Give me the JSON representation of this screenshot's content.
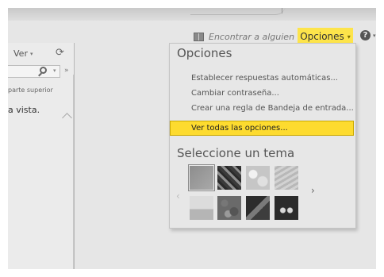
{
  "header": {
    "find_someone": "Encontrar a alguien",
    "options_label": "Opciones",
    "options_caret": "▾",
    "help_icon_glyph": "?",
    "help_caret": "▾"
  },
  "left_panel": {
    "view_label": "Ver",
    "view_caret": "▾",
    "refresh_glyph": "⟳",
    "search_dropdown_glyph": "▾",
    "expand_glyph": "»",
    "top_filter_text": "parte superior",
    "empty_view_text": "a vista."
  },
  "options_menu": {
    "title": "Opciones",
    "items": [
      {
        "label": "Establecer respuestas automáticas..."
      },
      {
        "label": "Cambiar contraseña..."
      },
      {
        "label": "Crear una regla de Bandeja de entrada..."
      },
      {
        "label": "Ver todas las opciones...",
        "highlighted": true
      }
    ],
    "theme_title": "Seleccione un tema",
    "theme_prev_glyph": "‹",
    "theme_next_glyph": "›",
    "themes": [
      {
        "name": "theme-gray-default",
        "selected": true
      },
      {
        "name": "theme-dark-pattern"
      },
      {
        "name": "theme-light-circles"
      },
      {
        "name": "theme-pale-texture"
      },
      {
        "name": "theme-pale-sky"
      },
      {
        "name": "theme-cartoon-faces"
      },
      {
        "name": "theme-dark-graphic"
      },
      {
        "name": "theme-dark-dots"
      }
    ]
  },
  "colors": {
    "highlight": "#fddb2f",
    "options_button": "#fde44b",
    "background": "#e6e6e6"
  }
}
